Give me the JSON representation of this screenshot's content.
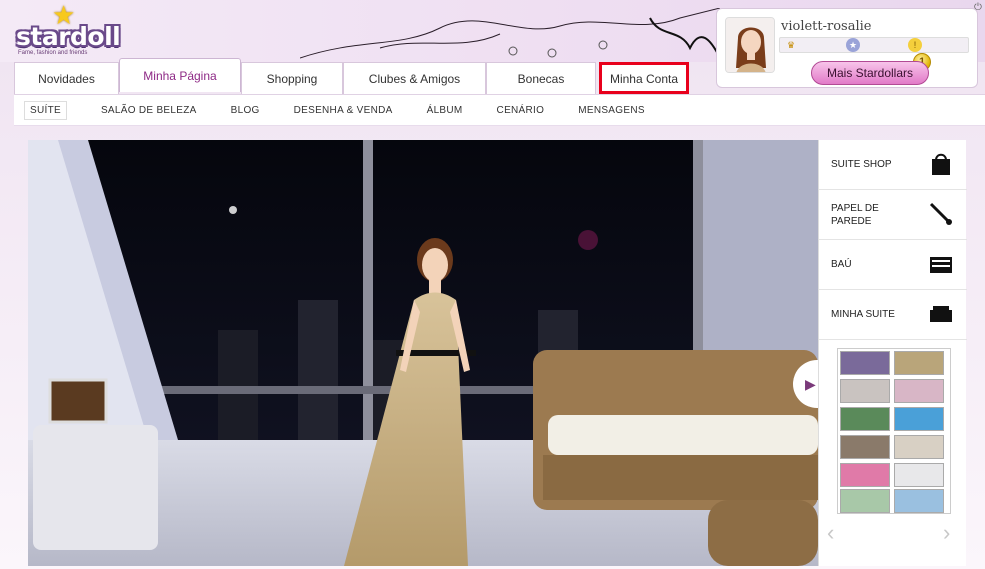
{
  "logo": {
    "name": "stardoll",
    "tagline": "Fame, fashion and friends"
  },
  "tabs": [
    {
      "label": "Novidades",
      "active": false,
      "highlighted": false
    },
    {
      "label": "Minha Página",
      "active": true,
      "highlighted": false
    },
    {
      "label": "Shopping",
      "active": false,
      "highlighted": false
    },
    {
      "label": "Clubes & Amigos",
      "active": false,
      "highlighted": false
    },
    {
      "label": "Bonecas",
      "active": false,
      "highlighted": false
    },
    {
      "label": "Minha Conta",
      "active": false,
      "highlighted": true
    }
  ],
  "user": {
    "name": "violett-rosalie",
    "coin_badge": "1",
    "button_label": "Mais Stardollars",
    "button_badge": "1"
  },
  "subnav": [
    "SUÍTE",
    "SALÃO DE BELEZA",
    "BLOG",
    "DESENHA & VENDA",
    "ÁLBUM",
    "CENÁRIO",
    "MENSAGENS"
  ],
  "side_panel": {
    "items": [
      {
        "label": "SUITE SHOP",
        "icon": "shopping-bag-icon"
      },
      {
        "label": "PAPEL DE PAREDE",
        "icon": "paintbrush-icon"
      },
      {
        "label": "BAÚ",
        "icon": "chest-icon"
      },
      {
        "label": "MINHA SUITE",
        "icon": "suite-icon"
      }
    ]
  },
  "colors": {
    "accent": "#8e2a86",
    "highlight_box": "#e8001c",
    "button_pink": "#e27ac8",
    "coin_gold": "#e2b300"
  }
}
